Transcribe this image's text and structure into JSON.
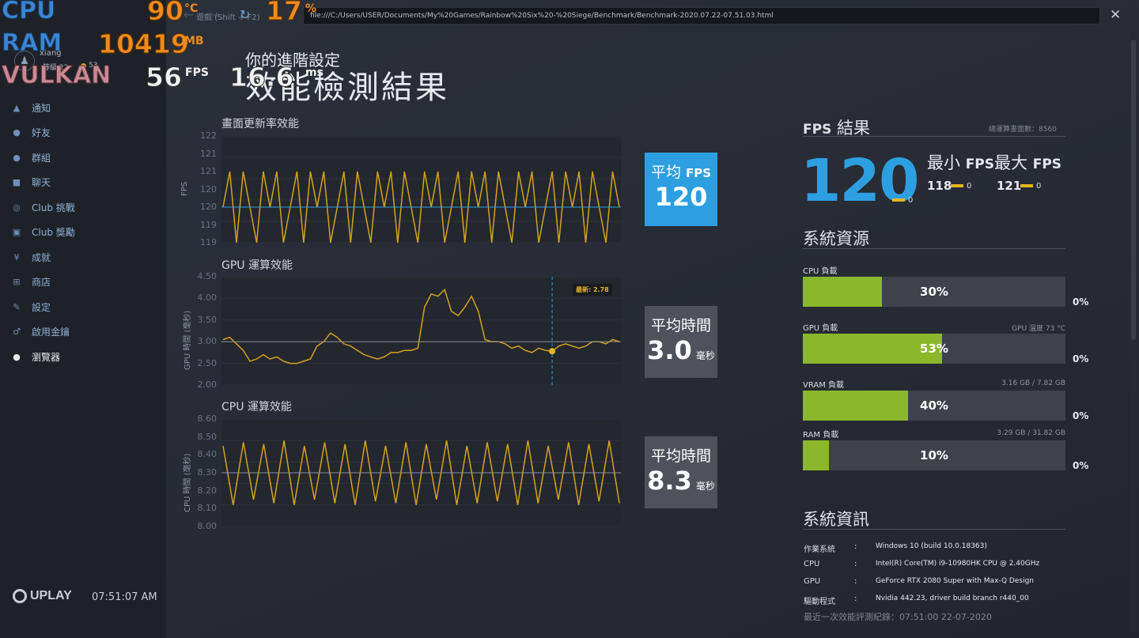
{
  "osd": {
    "cpu_label": "CPU",
    "cpu_temp": "90",
    "cpu_temp_unit": "°C",
    "cpu_load": "17",
    "cpu_load_unit": "%",
    "ram_label": "RAM",
    "ram_value": "10419",
    "ram_unit": "MB",
    "api_label": "VULKAN",
    "fps_value": "56",
    "fps_unit": "FPS",
    "frametime": "16.6",
    "frametime_unit": "ms"
  },
  "sidebar": {
    "nav_hint": "遊戲 (Shift + F2)",
    "username": "xiang",
    "level": "等級 22",
    "coins": "53",
    "items": [
      {
        "label": "通知",
        "icon": "bell-icon",
        "glyph": "▲"
      },
      {
        "label": "好友",
        "icon": "friends-icon",
        "glyph": "●"
      },
      {
        "label": "群組",
        "icon": "groups-icon",
        "glyph": "●"
      },
      {
        "label": "聊天",
        "icon": "chat-icon",
        "glyph": "■"
      },
      {
        "label": "Club 挑戰",
        "icon": "club-challenge-icon",
        "glyph": "◎"
      },
      {
        "label": "Club 獎勵",
        "icon": "club-reward-icon",
        "glyph": "▣"
      },
      {
        "label": "成就",
        "icon": "achievement-icon",
        "glyph": "¥"
      },
      {
        "label": "商店",
        "icon": "cart-icon",
        "glyph": "⊞"
      },
      {
        "label": "設定",
        "icon": "wrench-icon",
        "glyph": "✎"
      },
      {
        "label": "啟用金鑰",
        "icon": "key-icon",
        "glyph": "♂"
      },
      {
        "label": "瀏覽器",
        "icon": "globe-icon",
        "glyph": "●"
      }
    ],
    "logo": "UPLAY",
    "clock": "07:51:07 AM"
  },
  "browser": {
    "url": "file:///C:/Users/USER/Documents/My%20Games/Rainbow%20Six%20-%20Siege/Benchmark/Benchmark-2020.07.22-07.51.03.html",
    "back": "←",
    "forward": "→",
    "reload": "↻",
    "close": "✕"
  },
  "page": {
    "subtitle": "你的進階設定",
    "title": "效能檢測結果",
    "badge": "6"
  },
  "graphs": {
    "fps": {
      "title": "畫面更新率效能",
      "ylabel": "FPS",
      "yticks": [
        "122",
        "121",
        "121",
        "120",
        "120",
        "119",
        "119"
      ],
      "box_label": "平均",
      "box_label_en": "FPS",
      "box_value": "120",
      "box_unit": ""
    },
    "gpu": {
      "title": "GPU 運算效能",
      "ylabel": "GPU 時間 (毫秒)",
      "yticks": [
        "4.50",
        "4.00",
        "3.50",
        "3.00",
        "2.50",
        "2.00"
      ],
      "tooltip": "最新: 2.78",
      "box_label": "平均時間",
      "box_value": "3.0",
      "box_unit": "毫秒"
    },
    "cpu": {
      "title": "CPU 運算效能",
      "ylabel": "CPU 時間 (毫秒)",
      "yticks": [
        "8.60",
        "8.50",
        "8.40",
        "8.30",
        "8.20",
        "8.10",
        "8.00"
      ],
      "box_label": "平均時間",
      "box_value": "8.3",
      "box_unit": "毫秒"
    }
  },
  "fps_result": {
    "title_en": "FPS",
    "title": "結果",
    "frames_label": "總運算畫面數：8560",
    "avg": "120",
    "avg_sub": "0",
    "min_label": "最小",
    "max_label": "最大",
    "fps_en": "FPS",
    "min": "118",
    "min_sub": "0",
    "max": "121",
    "max_sub": "0"
  },
  "resources": {
    "title": "系統資源",
    "items": [
      {
        "label": "CPU 負載",
        "right": "",
        "percent": 30,
        "percent_label": "30%",
        "zero": "0%"
      },
      {
        "label": "GPU 負載",
        "right": "GPU 溫度 73 °C",
        "percent": 53,
        "percent_label": "53%",
        "zero": "0%"
      },
      {
        "label": "VRAM 負載",
        "right": "3.16 GB / 7.82 GB",
        "percent": 40,
        "percent_label": "40%",
        "zero": "0%"
      },
      {
        "label": "RAM 負載",
        "right": "3.29 GB / 31.82 GB",
        "percent": 10,
        "percent_label": "10%",
        "zero": "0%"
      }
    ]
  },
  "sysinfo": {
    "title": "系統資訊",
    "rows": [
      {
        "key": "作業系統",
        "value": "Windows 10 (build 10.0.18363)"
      },
      {
        "key": "CPU",
        "value": "Intel(R) Core(TM) i9-10980HK CPU @ 2.40GHz"
      },
      {
        "key": "GPU",
        "value": "GeForce RTX 2080 Super with Max-Q Design"
      },
      {
        "key": "驅動程式",
        "value": "Nvidia 442.23, driver build branch r440_00"
      }
    ],
    "colon": ":",
    "last_run": "最近一次效能評測紀錄：07:51:00 22-07-2020"
  },
  "colors": {
    "accent_blue": "#2d9fe0",
    "bar_green": "#8bb72a",
    "line_gold": "#d6a21e"
  },
  "chart_data": [
    {
      "type": "line",
      "title": "畫面更新率效能",
      "ylabel": "FPS",
      "ylim": [
        119,
        122
      ],
      "series": [
        {
          "values": [
            120,
            121,
            119,
            121,
            120,
            119,
            121,
            120,
            121,
            119,
            120,
            121,
            119,
            121,
            120,
            121,
            119,
            120,
            121,
            119,
            121,
            120,
            119,
            121,
            120,
            121,
            119,
            121,
            120,
            119,
            121,
            120,
            121,
            119,
            120,
            121,
            119,
            121,
            120,
            121,
            119,
            121,
            120,
            119,
            121,
            120,
            121,
            119,
            120,
            121,
            119,
            121,
            120,
            121,
            119,
            121,
            120,
            119,
            121,
            120
          ]
        }
      ]
    },
    {
      "type": "line",
      "title": "GPU 運算效能",
      "ylabel": "GPU 時間 (毫秒)",
      "ylim": [
        2.0,
        4.5
      ],
      "series": [
        {
          "values": [
            3.05,
            3.1,
            2.95,
            2.8,
            2.55,
            2.6,
            2.7,
            2.6,
            2.65,
            2.55,
            2.5,
            2.5,
            2.55,
            2.6,
            2.9,
            3.0,
            3.2,
            3.1,
            2.95,
            2.9,
            2.8,
            2.7,
            2.65,
            2.6,
            2.65,
            2.75,
            2.75,
            2.8,
            2.8,
            2.85,
            3.8,
            4.1,
            4.05,
            4.2,
            3.7,
            3.6,
            3.8,
            4.05,
            3.7,
            3.05,
            3.0,
            3.0,
            2.95,
            2.85,
            2.9,
            2.8,
            2.75,
            2.85,
            2.8,
            2.78,
            2.9,
            2.95,
            2.9,
            2.85,
            2.9,
            3.0,
            3.0,
            2.95,
            3.05,
            3.0
          ]
        }
      ]
    },
    {
      "type": "line",
      "title": "CPU 運算效能",
      "ylabel": "CPU 時間 (毫秒)",
      "ylim": [
        8.0,
        8.6
      ],
      "series": [
        {
          "values": [
            8.45,
            8.12,
            8.47,
            8.15,
            8.46,
            8.13,
            8.48,
            8.12,
            8.45,
            8.15,
            8.47,
            8.13,
            8.46,
            8.12,
            8.48,
            8.14,
            8.45,
            8.13,
            8.47,
            8.12,
            8.46,
            8.15,
            8.48,
            8.12,
            8.45,
            8.13,
            8.47,
            8.14,
            8.46,
            8.12,
            8.48,
            8.13,
            8.45,
            8.15,
            8.47,
            8.12,
            8.46,
            8.14,
            8.48,
            8.13
          ]
        }
      ]
    }
  ]
}
